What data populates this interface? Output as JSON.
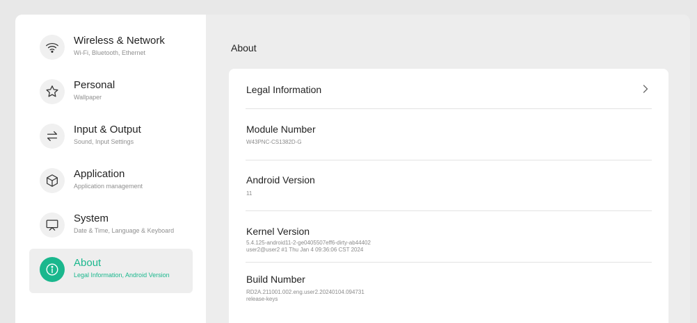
{
  "sidebar": {
    "items": [
      {
        "title": "Wireless & Network",
        "subtitle": "Wi-Fi, Bluetooth, Ethernet",
        "icon": "wifi-icon"
      },
      {
        "title": "Personal",
        "subtitle": "Wallpaper",
        "icon": "star-icon"
      },
      {
        "title": "Input & Output",
        "subtitle": "Sound, Input Settings",
        "icon": "swap-arrows-icon"
      },
      {
        "title": "Application",
        "subtitle": "Application management",
        "icon": "cube-icon"
      },
      {
        "title": "System",
        "subtitle": "Date & Time, Language & Keyboard",
        "icon": "monitor-icon"
      },
      {
        "title": "About",
        "subtitle": "Legal Information, Android Version",
        "icon": "info-icon",
        "active": true
      }
    ]
  },
  "main": {
    "title": "About",
    "rows": [
      {
        "title": "Legal Information"
      },
      {
        "title": "Module Number",
        "value": "W43PNC-CS1382D-G"
      },
      {
        "title": "Android Version",
        "value": "11"
      },
      {
        "title": "Kernel Version",
        "value_line1": "5.4.125-android11-2-ge0405507eff6-dirty-ab44402",
        "value_line2": "user2@user2 #1 Thu Jan 4 09:36:06 CST 2024"
      },
      {
        "title": "Build Number",
        "value_line1": "RD2A.211001.002.eng.user2.20240104.094731",
        "value_line2": "release-keys"
      }
    ]
  },
  "colors": {
    "accent": "#1ab78d",
    "background": "#ededed",
    "card": "#ffffff",
    "text_primary": "#222222",
    "text_secondary": "#8f8f8f"
  }
}
